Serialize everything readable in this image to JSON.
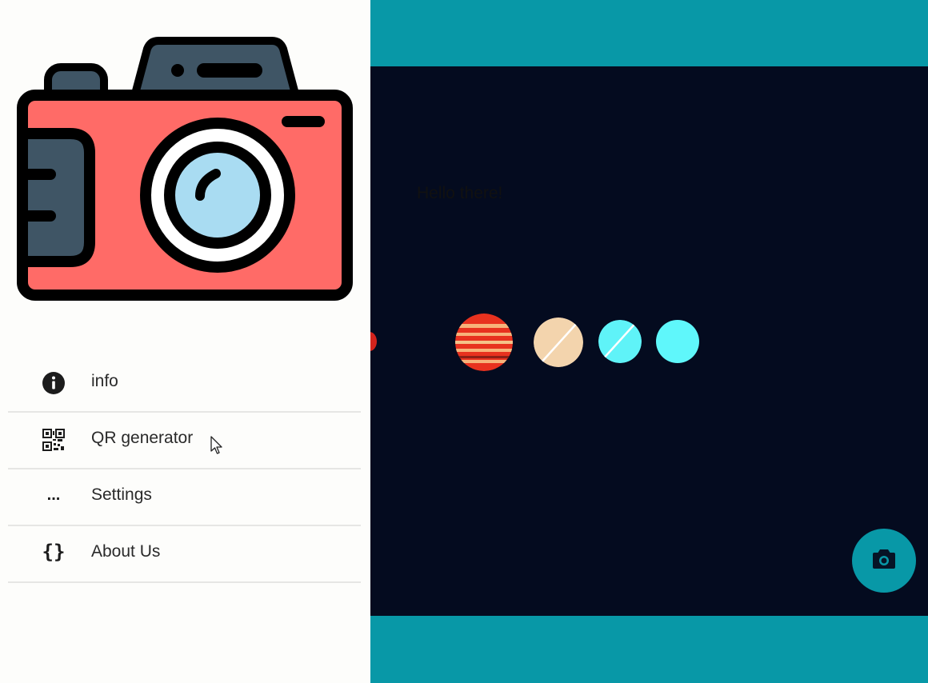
{
  "content": {
    "greeting": "Hello there!"
  },
  "drawer": {
    "menu": [
      {
        "label": "info",
        "icon": "info-icon"
      },
      {
        "label": "QR generator",
        "icon": "qr-code-icon"
      },
      {
        "label": "Settings",
        "icon": "ellipsis-icon",
        "glyph": "..."
      },
      {
        "label": "About Us",
        "icon": "code-braces-icon",
        "glyph": "{}"
      }
    ]
  },
  "colors": {
    "accent_teal": "#0898a7",
    "content_bg": "#040b1f",
    "drawer_bg": "#fdfdfb",
    "camera_body": "#ff6b67",
    "camera_dark": "#3f5565",
    "lens": "#a9dcf2"
  }
}
